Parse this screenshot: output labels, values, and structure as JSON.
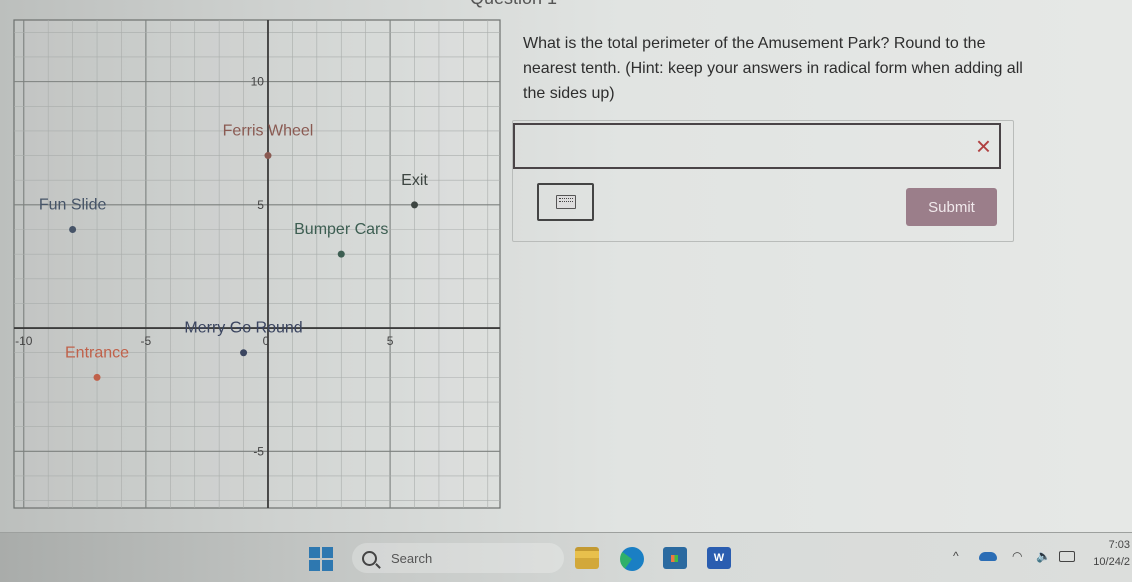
{
  "question": {
    "header": "Question 1",
    "text": "What is the total perimeter of the Amusement Park? Round to the nearest tenth.  (Hint: keep your answers in radical form when adding all the sides up)"
  },
  "answer": {
    "input_value": "",
    "input_placeholder": "",
    "clear_icon": "×",
    "keyboard_icon": "keyboard-icon",
    "submit_label": "Submit",
    "submit_color": "#9b7e8a",
    "clear_color": "#b04040"
  },
  "chart_data": {
    "type": "scatter",
    "title": "",
    "xlabel": "",
    "ylabel": "",
    "xlim": [
      -10.4,
      9.5
    ],
    "ylim": [
      -7.3,
      12.5
    ],
    "grid": true,
    "x_ticks": [
      -10,
      -5,
      0,
      5
    ],
    "x_tick_labels": [
      "-10",
      "-5",
      "0",
      "5"
    ],
    "y_ticks": [
      10,
      5,
      -5
    ],
    "y_tick_labels": [
      "10",
      "5",
      "-5"
    ],
    "points": [
      {
        "label": "Ferris Wheel",
        "x": 0,
        "y": 7,
        "color": "#8a5a52"
      },
      {
        "label": "Exit",
        "x": 6,
        "y": 5,
        "color": "#3e4642"
      },
      {
        "label": "Fun Slide",
        "x": -8,
        "y": 4,
        "color": "#465468"
      },
      {
        "label": "Bumper Cars",
        "x": 3,
        "y": 3,
        "color": "#3d5e52"
      },
      {
        "label": "Merry Go Round",
        "x": -1,
        "y": -1,
        "color": "#3b4560"
      },
      {
        "label": "Entrance",
        "x": -7,
        "y": -2,
        "color": "#c0614a"
      }
    ]
  },
  "taskbar": {
    "search_label": "Search",
    "apps": [
      "file-explorer",
      "edge",
      "microsoft-store",
      "word"
    ],
    "word_letter": "W",
    "tray_chevron": "^",
    "wifi_glyph": "◠",
    "volume_glyph": "🔈",
    "time": "7:03",
    "date": "10/24/2"
  }
}
